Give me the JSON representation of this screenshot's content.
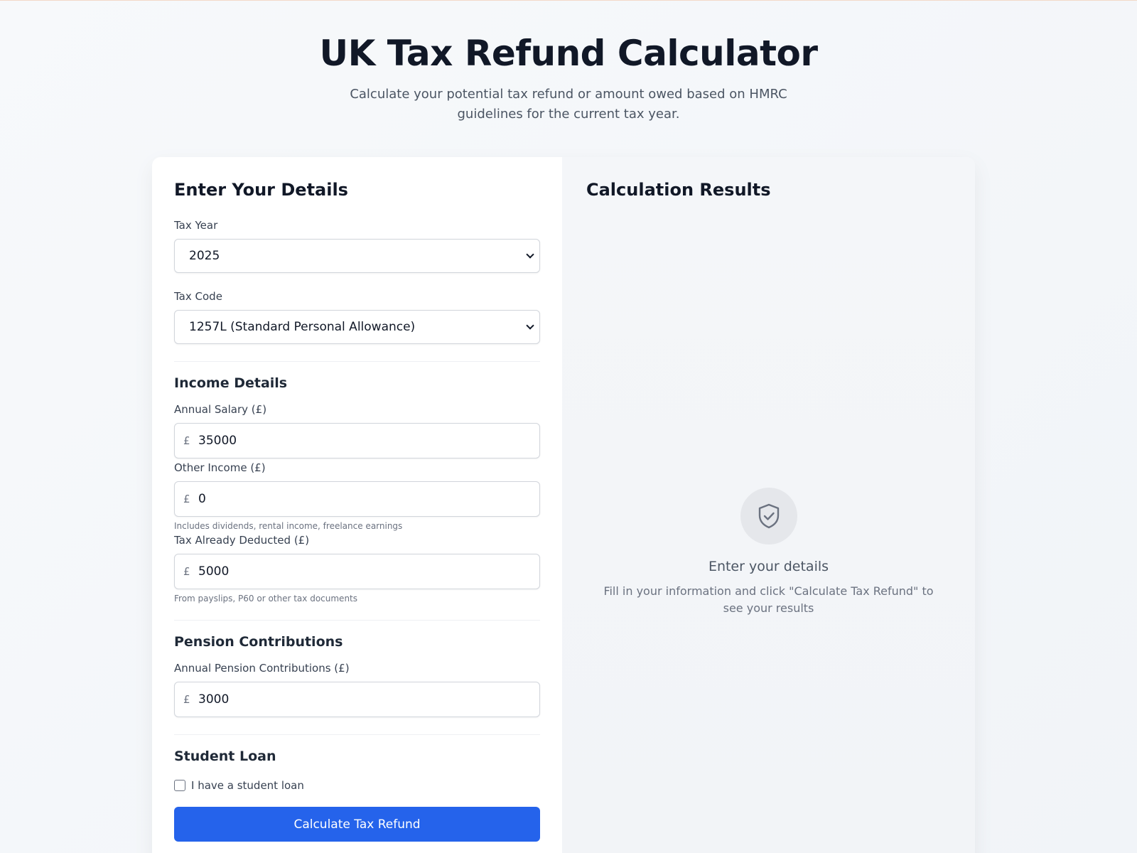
{
  "header": {
    "title": "UK Tax Refund Calculator",
    "subtitle": "Calculate your potential tax refund or amount owed based on HMRC guidelines for the current tax year."
  },
  "form": {
    "title": "Enter Your Details",
    "tax_year": {
      "label": "Tax Year",
      "value": "2025"
    },
    "tax_code": {
      "label": "Tax Code",
      "value": "1257L (Standard Personal Allowance)"
    },
    "income": {
      "section_title": "Income Details",
      "salary": {
        "label": "Annual Salary (£)",
        "currency": "£",
        "value": "35000"
      },
      "other_income": {
        "label": "Other Income (£)",
        "currency": "£",
        "value": "0",
        "help": "Includes dividends, rental income, freelance earnings"
      },
      "tax_deducted": {
        "label": "Tax Already Deducted (£)",
        "currency": "£",
        "value": "5000",
        "help": "From payslips, P60 or other tax documents"
      }
    },
    "pension": {
      "section_title": "Pension Contributions",
      "contributions": {
        "label": "Annual Pension Contributions (£)",
        "currency": "£",
        "value": "3000"
      }
    },
    "student_loan": {
      "section_title": "Student Loan",
      "checkbox_label": "I have a student loan",
      "checked": false
    },
    "submit_label": "Calculate Tax Refund"
  },
  "results": {
    "title": "Calculation Results",
    "empty_icon": "shield-check-icon",
    "empty_title": "Enter your details",
    "empty_text": "Fill in your information and click \"Calculate Tax Refund\" to see your results"
  },
  "colors": {
    "accent": "#2563eb",
    "text": "#111827",
    "muted": "#6b7280"
  }
}
